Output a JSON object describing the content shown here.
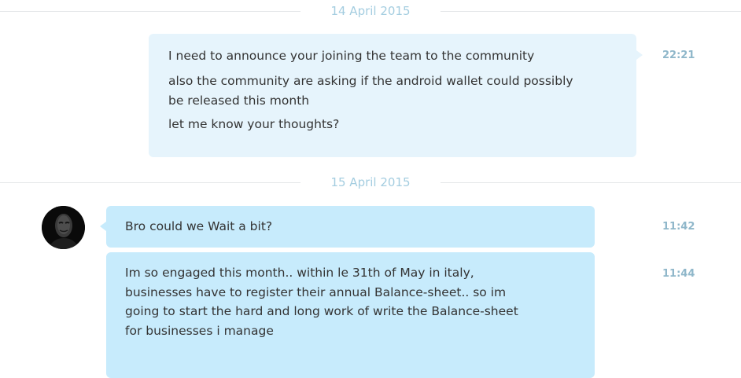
{
  "conversation": {
    "date_separators": [
      "14 April 2015",
      "15 April 2015"
    ],
    "messages": [
      {
        "direction": "outgoing",
        "time": "22:21",
        "lines": [
          "I need to announce your joining the team to the community",
          "also the community are asking if the android wallet could possibly be released this month",
          "let me know your thoughts?"
        ]
      },
      {
        "direction": "incoming",
        "time": "11:42",
        "lines": [
          "Bro could we Wait a bit?"
        ]
      },
      {
        "direction": "incoming",
        "time": "11:44",
        "lines": [
          "Im so engaged this month.. within le 31th of May in italy, businesses have to register their annual Balance-sheet.. so im going to start the hard and long work of write the Balance-sheet for businesses i manage"
        ]
      }
    ]
  },
  "colors": {
    "outgoing_bubble": "#e6f4fc",
    "incoming_bubble": "#c7ebfc",
    "date_text": "#a4cde0",
    "time_text": "#8fb7ca"
  },
  "icons": {
    "contact_avatar": "anonymous-mask-avatar"
  }
}
